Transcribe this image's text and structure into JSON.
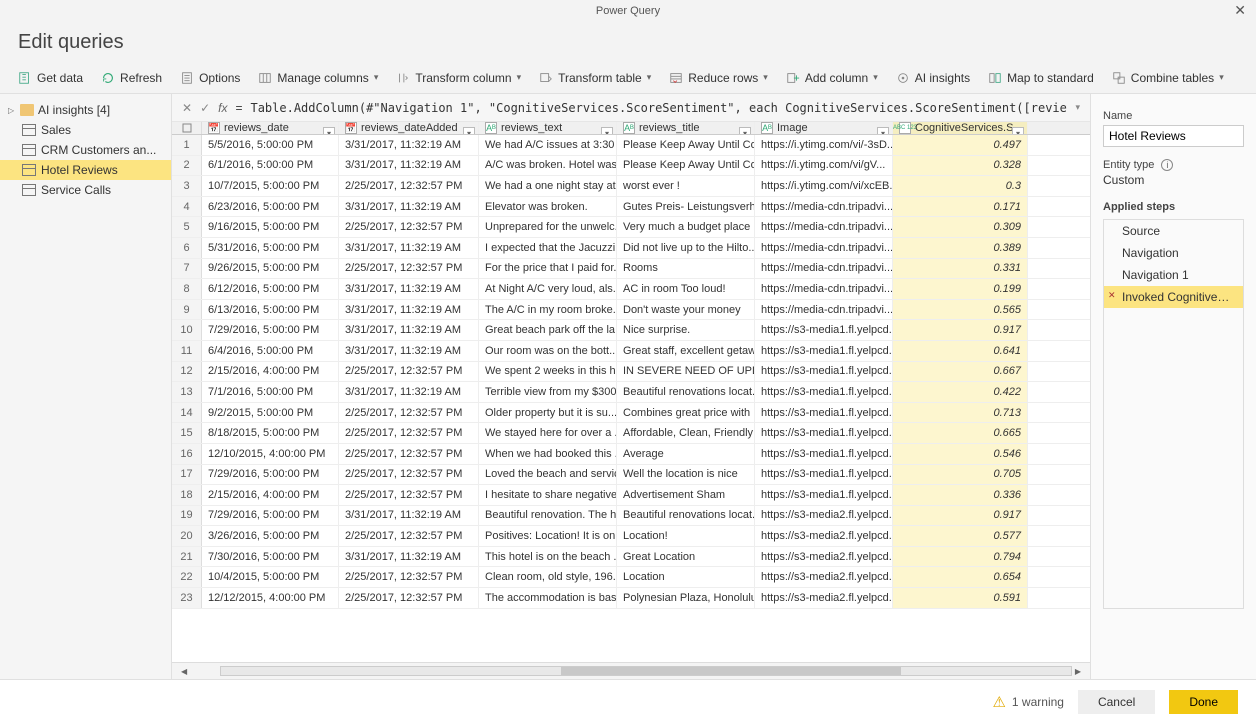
{
  "window": {
    "app_title": "Power Query",
    "page_title": "Edit queries"
  },
  "ribbon": {
    "get_data": "Get data",
    "refresh": "Refresh",
    "options": "Options",
    "manage_columns": "Manage columns",
    "transform_column": "Transform column",
    "transform_table": "Transform table",
    "reduce_rows": "Reduce rows",
    "add_column": "Add column",
    "ai_insights": "AI insights",
    "map_standard": "Map to standard",
    "combine_tables": "Combine tables"
  },
  "queries": {
    "root_label": "AI insights [4]",
    "items": [
      {
        "label": "Sales"
      },
      {
        "label": "CRM Customers an..."
      },
      {
        "label": "Hotel Reviews",
        "selected": true
      },
      {
        "label": "Service Calls"
      }
    ]
  },
  "formula": {
    "eq": "=",
    "text": "Table.AddColumn(#\"Navigation 1\", \"CognitiveServices.ScoreSentiment\", each CognitiveServices.ScoreSentiment([reviews_text], \"en\"))"
  },
  "columns": {
    "date": "reviews_date",
    "added": "reviews_dateAdded",
    "text": "reviews_text",
    "title": "reviews_title",
    "image": "Image",
    "score": "CognitiveServices.S..."
  },
  "col_type_label": "ABC\n123",
  "rows": [
    {
      "n": 1,
      "date": "5/5/2016, 5:00:00 PM",
      "added": "3/31/2017, 11:32:19 AM",
      "text": "We had A/C issues at 3:30 ...",
      "title": "Please Keep Away Until Co...",
      "image": "https://i.ytimg.com/vi/-3sD...",
      "score": "0.497"
    },
    {
      "n": 2,
      "date": "6/1/2016, 5:00:00 PM",
      "added": "3/31/2017, 11:32:19 AM",
      "text": "A/C was broken. Hotel was...",
      "title": "Please Keep Away Until Co...",
      "image": "https://i.ytimg.com/vi/gV...",
      "score": "0.328"
    },
    {
      "n": 3,
      "date": "10/7/2015, 5:00:00 PM",
      "added": "2/25/2017, 12:32:57 PM",
      "text": "We had a one night stay at...",
      "title": "worst ever !",
      "image": "https://i.ytimg.com/vi/xcEB...",
      "score": "0.3"
    },
    {
      "n": 4,
      "date": "6/23/2016, 5:00:00 PM",
      "added": "3/31/2017, 11:32:19 AM",
      "text": "Elevator was broken.",
      "title": "Gutes Preis- Leistungsverh...",
      "image": "https://media-cdn.tripadvi...",
      "score": "0.171"
    },
    {
      "n": 5,
      "date": "9/16/2015, 5:00:00 PM",
      "added": "2/25/2017, 12:32:57 PM",
      "text": "Unprepared for the unwelc...",
      "title": "Very much a budget place",
      "image": "https://media-cdn.tripadvi...",
      "score": "0.309"
    },
    {
      "n": 6,
      "date": "5/31/2016, 5:00:00 PM",
      "added": "3/31/2017, 11:32:19 AM",
      "text": "I expected that the Jacuzzi ...",
      "title": "Did not live up to the Hilto...",
      "image": "https://media-cdn.tripadvi...",
      "score": "0.389"
    },
    {
      "n": 7,
      "date": "9/26/2015, 5:00:00 PM",
      "added": "2/25/2017, 12:32:57 PM",
      "text": "For the price that I paid for...",
      "title": "Rooms",
      "image": "https://media-cdn.tripadvi...",
      "score": "0.331"
    },
    {
      "n": 8,
      "date": "6/12/2016, 5:00:00 PM",
      "added": "3/31/2017, 11:32:19 AM",
      "text": "At Night A/C very loud, als...",
      "title": "AC in room Too loud!",
      "image": "https://media-cdn.tripadvi...",
      "score": "0.199"
    },
    {
      "n": 9,
      "date": "6/13/2016, 5:00:00 PM",
      "added": "3/31/2017, 11:32:19 AM",
      "text": "The A/C in my room broke...",
      "title": "Don't waste your money",
      "image": "https://media-cdn.tripadvi...",
      "score": "0.565"
    },
    {
      "n": 10,
      "date": "7/29/2016, 5:00:00 PM",
      "added": "3/31/2017, 11:32:19 AM",
      "text": "Great beach park off the la...",
      "title": "Nice surprise.",
      "image": "https://s3-media1.fl.yelpcd...",
      "score": "0.917"
    },
    {
      "n": 11,
      "date": "6/4/2016, 5:00:00 PM",
      "added": "3/31/2017, 11:32:19 AM",
      "text": "Our room was on the bott...",
      "title": "Great staff, excellent getaw...",
      "image": "https://s3-media1.fl.yelpcd...",
      "score": "0.641"
    },
    {
      "n": 12,
      "date": "2/15/2016, 4:00:00 PM",
      "added": "2/25/2017, 12:32:57 PM",
      "text": "We spent 2 weeks in this h...",
      "title": "IN SEVERE NEED OF UPDA...",
      "image": "https://s3-media1.fl.yelpcd...",
      "score": "0.667"
    },
    {
      "n": 13,
      "date": "7/1/2016, 5:00:00 PM",
      "added": "3/31/2017, 11:32:19 AM",
      "text": "Terrible view from my $300...",
      "title": "Beautiful renovations locat...",
      "image": "https://s3-media1.fl.yelpcd...",
      "score": "0.422"
    },
    {
      "n": 14,
      "date": "9/2/2015, 5:00:00 PM",
      "added": "2/25/2017, 12:32:57 PM",
      "text": "Older property but it is su...",
      "title": "Combines great price with ...",
      "image": "https://s3-media1.fl.yelpcd...",
      "score": "0.713"
    },
    {
      "n": 15,
      "date": "8/18/2015, 5:00:00 PM",
      "added": "2/25/2017, 12:32:57 PM",
      "text": "We stayed here for over a ...",
      "title": "Affordable, Clean, Friendly ...",
      "image": "https://s3-media1.fl.yelpcd...",
      "score": "0.665"
    },
    {
      "n": 16,
      "date": "12/10/2015, 4:00:00 PM",
      "added": "2/25/2017, 12:32:57 PM",
      "text": "When we had booked this ...",
      "title": "Average",
      "image": "https://s3-media1.fl.yelpcd...",
      "score": "0.546"
    },
    {
      "n": 17,
      "date": "7/29/2016, 5:00:00 PM",
      "added": "2/25/2017, 12:32:57 PM",
      "text": "Loved the beach and service",
      "title": "Well the location is nice",
      "image": "https://s3-media1.fl.yelpcd...",
      "score": "0.705"
    },
    {
      "n": 18,
      "date": "2/15/2016, 4:00:00 PM",
      "added": "2/25/2017, 12:32:57 PM",
      "text": "I hesitate to share negative...",
      "title": "Advertisement Sham",
      "image": "https://s3-media1.fl.yelpcd...",
      "score": "0.336"
    },
    {
      "n": 19,
      "date": "7/29/2016, 5:00:00 PM",
      "added": "3/31/2017, 11:32:19 AM",
      "text": "Beautiful renovation. The h...",
      "title": "Beautiful renovations locat...",
      "image": "https://s3-media2.fl.yelpcd...",
      "score": "0.917"
    },
    {
      "n": 20,
      "date": "3/26/2016, 5:00:00 PM",
      "added": "2/25/2017, 12:32:57 PM",
      "text": "Positives: Location! It is on ...",
      "title": "Location!",
      "image": "https://s3-media2.fl.yelpcd...",
      "score": "0.577"
    },
    {
      "n": 21,
      "date": "7/30/2016, 5:00:00 PM",
      "added": "3/31/2017, 11:32:19 AM",
      "text": "This hotel is on the beach ...",
      "title": "Great Location",
      "image": "https://s3-media2.fl.yelpcd...",
      "score": "0.794"
    },
    {
      "n": 22,
      "date": "10/4/2015, 5:00:00 PM",
      "added": "2/25/2017, 12:32:57 PM",
      "text": "Clean room, old style, 196...",
      "title": "Location",
      "image": "https://s3-media2.fl.yelpcd...",
      "score": "0.654"
    },
    {
      "n": 23,
      "date": "12/12/2015, 4:00:00 PM",
      "added": "2/25/2017, 12:32:57 PM",
      "text": "The accommodation is bas...",
      "title": "Polynesian Plaza, Honolulu",
      "image": "https://s3-media2.fl.yelpcd...",
      "score": "0.591"
    }
  ],
  "right": {
    "name_label": "Name",
    "name_value": "Hotel Reviews",
    "entity_label": "Entity type",
    "entity_value": "Custom",
    "steps_label": "Applied steps",
    "steps": [
      {
        "label": "Source"
      },
      {
        "label": "Navigation"
      },
      {
        "label": "Navigation 1"
      },
      {
        "label": "Invoked CognitiveSer...",
        "selected": true
      }
    ]
  },
  "footer": {
    "warning": "1 warning",
    "cancel": "Cancel",
    "done": "Done"
  }
}
